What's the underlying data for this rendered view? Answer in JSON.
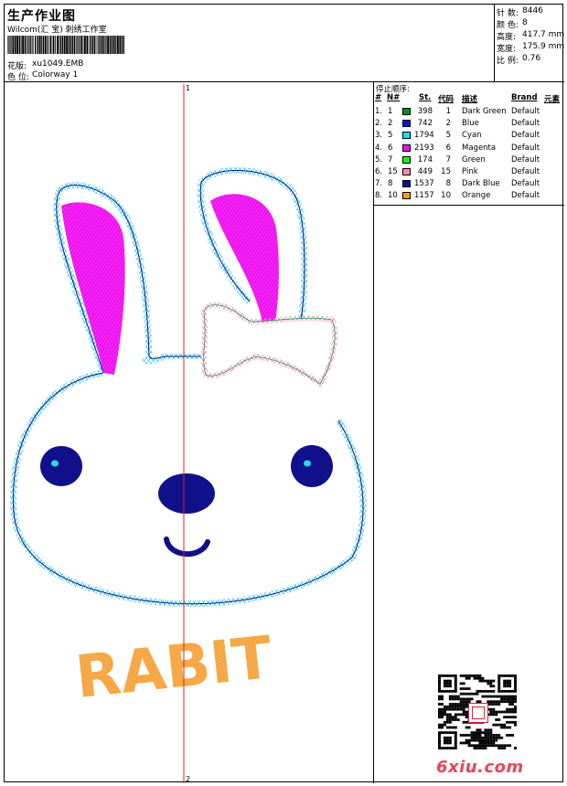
{
  "header": {
    "title": "生产作业图",
    "company": "Wilcom(汇 宝) 刺绣工作室",
    "design_label": "花版:",
    "design_value": "xu1049.EMB",
    "colorway_label": "色 位:",
    "colorway_value": "Colorway 1"
  },
  "stats": {
    "stitches_label": "针 数:",
    "stitches_value": "8446",
    "colors_label": "颜 色:",
    "colors_value": "8",
    "height_label": "高度:",
    "height_value": "417.7 mm",
    "width_label": "宽度:",
    "width_value": "175.9 mm",
    "ratio_label": "比 例:",
    "ratio_value": "0.76"
  },
  "design": {
    "top_marker": "1",
    "bottom_marker": "2",
    "text": "RABIT"
  },
  "sequence": {
    "title": "停止顺序:",
    "headers": [
      "#",
      "N#",
      "St.",
      "代码",
      "描述",
      "Brand",
      "元素"
    ],
    "rows": [
      {
        "idx": "1.",
        "n": "1",
        "st": "398",
        "code": "1",
        "desc": "Dark Green",
        "brand": "Default",
        "color": "#0a8a2a"
      },
      {
        "idx": "2.",
        "n": "2",
        "st": "742",
        "code": "2",
        "desc": "Blue",
        "brand": "Default",
        "color": "#1010ee"
      },
      {
        "idx": "3.",
        "n": "5",
        "st": "1794",
        "code": "5",
        "desc": "Cyan",
        "brand": "Default",
        "color": "#22ddee"
      },
      {
        "idx": "4.",
        "n": "6",
        "st": "2193",
        "code": "6",
        "desc": "Magenta",
        "brand": "Default",
        "color": "#ee10ee"
      },
      {
        "idx": "5.",
        "n": "7",
        "st": "174",
        "code": "7",
        "desc": "Green",
        "brand": "Default",
        "color": "#22ee22"
      },
      {
        "idx": "6.",
        "n": "15",
        "st": "449",
        "code": "15",
        "desc": "Pink",
        "brand": "Default",
        "color": "#f08ab8"
      },
      {
        "idx": "7.",
        "n": "8",
        "st": "1537",
        "code": "8",
        "desc": "Dark Blue",
        "brand": "Default",
        "color": "#10108a"
      },
      {
        "idx": "8.",
        "n": "10",
        "st": "1157",
        "code": "10",
        "desc": "Orange",
        "brand": "Default",
        "color": "#f59a30"
      }
    ]
  },
  "watermark": {
    "text": "6xiu.com"
  },
  "colors": {
    "cyan": "#22ccee",
    "dark_blue": "#10108a",
    "magenta": "#ee10ee",
    "orange": "#f5a540",
    "pink": "#f08ab8",
    "red_line": "#dd2222"
  }
}
